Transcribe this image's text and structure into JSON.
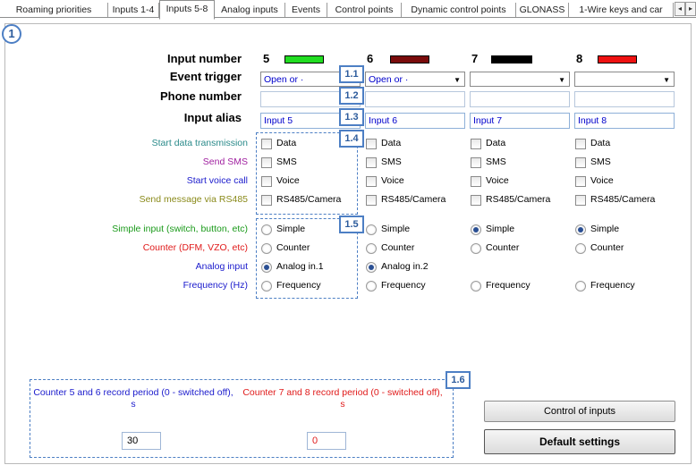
{
  "tabs": [
    "Roaming priorities",
    "Inputs 1-4",
    "Inputs 5-8",
    "Analog inputs",
    "Events",
    "Control points",
    "Dynamic control points",
    "GLONASS",
    "1-Wire keys and car"
  ],
  "tab_scroll": {
    "left": "◂",
    "right": "▸"
  },
  "section_marker": "1",
  "rows": {
    "input_number": "Input number",
    "event_trigger": "Event trigger",
    "phone_number": "Phone number",
    "input_alias": "Input alias"
  },
  "inputs": [
    {
      "number": "5",
      "swatch_color": "#22dd22",
      "trigger": "Open or ·",
      "alias": "Input 5"
    },
    {
      "number": "6",
      "swatch_color": "#7a0b0b",
      "trigger": "Open or ·",
      "alias": "Input 6"
    },
    {
      "number": "7",
      "swatch_color": "#000000",
      "trigger": "",
      "alias": "Input 7"
    },
    {
      "number": "8",
      "swatch_color": "#ee1111",
      "trigger": "",
      "alias": "Input 8"
    }
  ],
  "actions": [
    {
      "label": "Start data transmission",
      "color": "#2a8a8a",
      "option": "Data"
    },
    {
      "label": "Send SMS",
      "color": "#a020a0",
      "option": "SMS"
    },
    {
      "label": "Start voice call",
      "color": "#1a1acc",
      "option": "Voice"
    },
    {
      "label": "Send message via RS485",
      "color": "#8a8a1a",
      "option": "RS485/Camera"
    }
  ],
  "modes": [
    {
      "label": "Simple input (switch, button, etc)",
      "color": "#1a9a1a",
      "option": "Simple"
    },
    {
      "label": "Counter (DFM, VZO, etc)",
      "color": "#e01b1b",
      "option": "Counter"
    },
    {
      "label": "Analog input",
      "color": "#1a1acc",
      "option": "Analog in.1",
      "option_col2": "Analog in.2"
    },
    {
      "label": "Frequency (Hz)",
      "color": "#1a1acc",
      "option": "Frequency"
    }
  ],
  "mode_selected": [
    "Analog input",
    "Analog input",
    "Simple",
    "Simple"
  ],
  "badges": {
    "b11": "1.1",
    "b12": "1.2",
    "b13": "1.3",
    "b14": "1.4",
    "b15": "1.5",
    "b16": "1.6"
  },
  "counter56": {
    "label": "Counter 5 and 6 record period (0 - switched off), s",
    "value": "30",
    "color": "#1a1acc"
  },
  "counter78": {
    "label": "Counter 7 and 8 record period (0 - switched off), s",
    "value": "0",
    "color": "#e01b1b"
  },
  "buttons": {
    "control_inputs": "Control of inputs",
    "default_settings": "Default settings"
  }
}
